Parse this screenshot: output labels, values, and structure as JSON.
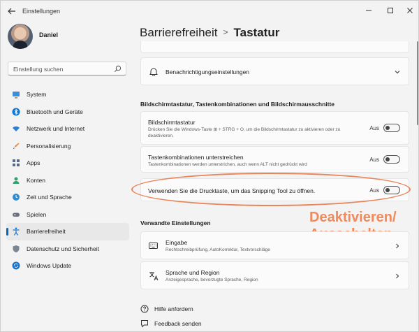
{
  "window": {
    "app_title": "Einstellungen"
  },
  "user": {
    "name": "Daniel"
  },
  "search": {
    "placeholder": "Einstellung suchen"
  },
  "sidebar": {
    "items": [
      {
        "label": "System",
        "icon": "monitor-icon"
      },
      {
        "label": "Bluetooth und Geräte",
        "icon": "bluetooth-icon"
      },
      {
        "label": "Netzwerk und Internet",
        "icon": "wifi-icon"
      },
      {
        "label": "Personalisierung",
        "icon": "brush-icon"
      },
      {
        "label": "Apps",
        "icon": "apps-icon"
      },
      {
        "label": "Konten",
        "icon": "person-icon"
      },
      {
        "label": "Zeit und Sprache",
        "icon": "globe-clock-icon"
      },
      {
        "label": "Spielen",
        "icon": "gamepad-icon"
      },
      {
        "label": "Barrierefreiheit",
        "icon": "accessibility-icon"
      },
      {
        "label": "Datenschutz und Sicherheit",
        "icon": "shield-icon"
      },
      {
        "label": "Windows Update",
        "icon": "update-icon"
      }
    ],
    "active_index": 8
  },
  "breadcrumb": {
    "parent": "Barrierefreiheit",
    "separator": ">",
    "current": "Tastatur"
  },
  "notifications_row": {
    "label": "Benachrichtigungseinstellungen"
  },
  "section_keyboard": {
    "heading": "Bildschirmtastatur, Tastenkombinationen und Bildschirmausschnitte",
    "rows": [
      {
        "title": "Bildschirmtastatur",
        "subtitle": "Drücken Sie die Windows-Taste ⊞ + STRG + O, um die Bildschirmtastatur zu aktivieren oder zu deaktivieren.",
        "state": "Aus",
        "on": false
      },
      {
        "title": "Tastenkombinationen unterstreichen",
        "subtitle": "Tastenkombinationen werden unterstrichen, auch wenn ALT nicht gedrückt wird",
        "state": "Aus",
        "on": false
      },
      {
        "title": "Verwenden Sie die Drucktaste, um das Snipping Tool zu öffnen.",
        "subtitle": "",
        "state": "Aus",
        "on": false
      }
    ]
  },
  "annotation": {
    "text": "Deaktivieren/\nAusschalten",
    "color": "#ef8a5d"
  },
  "section_related": {
    "heading": "Verwandte Einstellungen",
    "rows": [
      {
        "title": "Eingabe",
        "subtitle": "Rechtschreibprüfung, AutoKorrektur, Textvorschläge",
        "icon": "keyboard-icon"
      },
      {
        "title": "Sprache und Region",
        "subtitle": "Anzeigesprache, bevorzugte Sprache, Region",
        "icon": "language-icon"
      }
    ]
  },
  "footer_links": [
    {
      "label": "Hilfe anfordern",
      "icon": "help-icon"
    },
    {
      "label": "Feedback senden",
      "icon": "feedback-icon"
    }
  ],
  "colors": {
    "accent": "#0067c0",
    "annotation": "#ef8a5d"
  }
}
